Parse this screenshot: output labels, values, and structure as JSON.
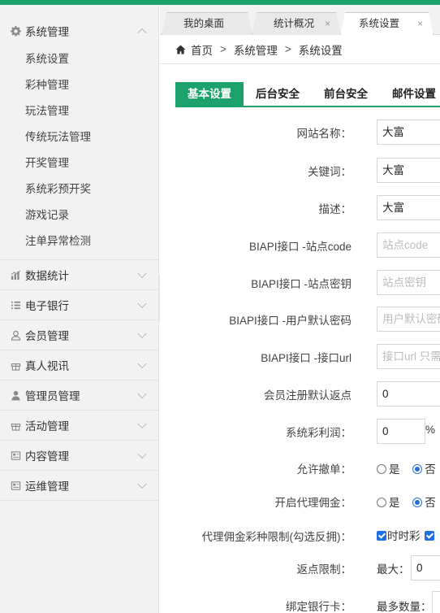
{
  "colors": {
    "accent": "#1aa26a",
    "radio_checked": "#2a6fd6"
  },
  "tabs": [
    {
      "label": "我的桌面",
      "closable": false
    },
    {
      "label": "统计概况",
      "close": "×"
    },
    {
      "label": "系统设置",
      "close": "×",
      "active": true
    }
  ],
  "breadcrumb": {
    "home": "首页",
    "sep": ">",
    "level1": "系统管理",
    "level2": "系统设置"
  },
  "sidebar": {
    "open_group": {
      "label": "系统管理",
      "icon": "gear-icon",
      "items": [
        "系统设置",
        "彩种管理",
        "玩法管理",
        "传统玩法管理",
        "开奖管理",
        "系统彩预开奖",
        "游戏记录",
        "注单异常检测"
      ]
    },
    "groups": [
      {
        "label": "数据统计",
        "icon": "bar-chart-icon"
      },
      {
        "label": "电子银行",
        "icon": "list-icon"
      },
      {
        "label": "会员管理",
        "icon": "user-icon"
      },
      {
        "label": "真人视讯",
        "icon": "gift-icon"
      },
      {
        "label": "管理员管理",
        "icon": "user-solid-icon"
      },
      {
        "label": "活动管理",
        "icon": "gift-icon"
      },
      {
        "label": "内容管理",
        "icon": "document-icon"
      },
      {
        "label": "运维管理",
        "icon": "document-icon"
      }
    ]
  },
  "content_tabs": [
    "基本设置",
    "后台安全",
    "前台安全",
    "邮件设置"
  ],
  "form": {
    "site_name": {
      "label": "网站名称：",
      "value": "大富"
    },
    "keywords": {
      "label": "关键词：",
      "value": "大富"
    },
    "description": {
      "label": "描述：",
      "value": "大富"
    },
    "biapi_site_code": {
      "label": "BIAPI接口 -站点code",
      "placeholder": "站点code"
    },
    "biapi_site_key": {
      "label": "BIAPI接口 -站点密钥",
      "placeholder": "站点密钥"
    },
    "biapi_user_pwd": {
      "label": "BIAPI接口 -用户默认密码",
      "placeholder": "用户默认密码"
    },
    "biapi_url": {
      "label": "BIAPI接口 -接口url",
      "placeholder": "接口url 只需"
    },
    "register_rebate": {
      "label": "会员注册默认返点",
      "value": "0"
    },
    "lottery_profit": {
      "label": "系统彩利润：",
      "value": "0",
      "unit": "%"
    },
    "allow_cancel": {
      "label": "允许撤单：",
      "yes": "是",
      "no": "否",
      "selected": "no"
    },
    "agent_commission": {
      "label": "开启代理佣金：",
      "yes": "是",
      "no": "否",
      "selected": "no"
    },
    "agent_lottery_limit": {
      "label": "代理佣金彩种限制(勾选反拥)：",
      "option1": "时时彩"
    },
    "rebate_limit": {
      "label": "返点限制：",
      "max_label": "最大：",
      "max_value": "0"
    },
    "bind_bank": {
      "label": "绑定银行卡：",
      "max_label": "最多数量："
    }
  }
}
